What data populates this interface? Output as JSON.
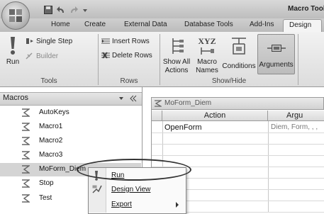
{
  "window": {
    "title": "Macro Tool"
  },
  "tabs": [
    {
      "label": "Home"
    },
    {
      "label": "Create"
    },
    {
      "label": "External Data"
    },
    {
      "label": "Database Tools"
    },
    {
      "label": "Add-Ins"
    },
    {
      "label": "Design"
    }
  ],
  "ribbon": {
    "tools": {
      "run": "Run",
      "single_step": "Single Step",
      "builder": "Builder",
      "label": "Tools"
    },
    "rows": {
      "insert_rows": "Insert Rows",
      "delete_rows": "Delete Rows",
      "label": "Rows"
    },
    "show_hide": {
      "show_all_1": "Show All",
      "show_all_2": "Actions",
      "macro_names_1": "Macro",
      "macro_names_2": "Names",
      "conditions": "Conditions",
      "arguments": "Arguments",
      "xyz": "XYZ",
      "label": "Show/Hide"
    }
  },
  "nav": {
    "title": "Macros",
    "items": [
      {
        "label": "AutoKeys"
      },
      {
        "label": "Macro1"
      },
      {
        "label": "Macro2"
      },
      {
        "label": "Macro3"
      },
      {
        "label": "MoForm_Diem"
      },
      {
        "label": "Stop"
      },
      {
        "label": "Test"
      }
    ]
  },
  "document": {
    "tab_title": "MoForm_Diem",
    "columns": [
      "Action",
      "Argu"
    ],
    "rows": [
      {
        "action": "OpenForm",
        "arguments": "Diem, Form, , ,"
      }
    ]
  },
  "context_menu": {
    "items": [
      {
        "label": "Run"
      },
      {
        "label": "Design View"
      },
      {
        "label": "Export"
      }
    ]
  }
}
